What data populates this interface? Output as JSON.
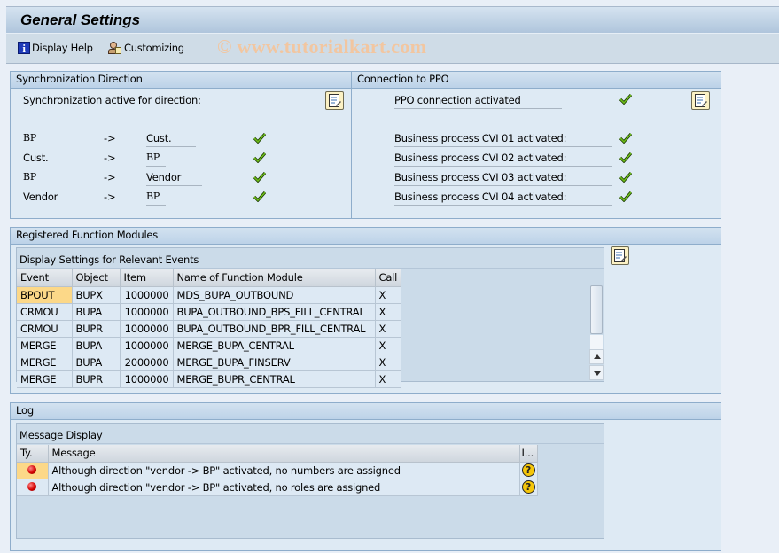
{
  "header": {
    "title": "General Settings",
    "watermark": "© www.tutorialkart.com"
  },
  "toolbar": {
    "display_help": "Display Help",
    "customizing": "Customizing"
  },
  "sync_direction": {
    "title": "Synchronization Direction",
    "label": "Synchronization active for direction:",
    "rows": [
      {
        "from": "BP",
        "arrow": "->",
        "to": "Cust.",
        "active": true
      },
      {
        "from": "Cust.",
        "arrow": "->",
        "to": "BP",
        "active": true
      },
      {
        "from": "BP",
        "arrow": "->",
        "to": "Vendor",
        "active": true
      },
      {
        "from": "Vendor",
        "arrow": "->",
        "to": "BP",
        "active": true
      }
    ]
  },
  "ppo": {
    "title": "Connection to PPO",
    "connection_label": "PPO connection activated",
    "connection_active": true,
    "processes": [
      {
        "label": "Business process CVI 01 activated:",
        "active": true
      },
      {
        "label": "Business process CVI 02 activated:",
        "active": true
      },
      {
        "label": "Business process CVI 03 activated:",
        "active": true
      },
      {
        "label": "Business process CVI 04 activated:",
        "active": true
      }
    ]
  },
  "function_modules": {
    "title": "Registered Function Modules",
    "table_title": "Display Settings for Relevant Events",
    "columns": [
      "Event",
      "Object",
      "Item",
      "Name of Function Module",
      "Call"
    ],
    "rows": [
      [
        "BPOUT",
        "BUPX",
        "1000000",
        "MDS_BUPA_OUTBOUND",
        "X"
      ],
      [
        "CRMOU",
        "BUPA",
        "1000000",
        "BUPA_OUTBOUND_BPS_FILL_CENTRAL",
        "X"
      ],
      [
        "CRMOU",
        "BUPR",
        "1000000",
        "BUPA_OUTBOUND_BPR_FILL_CENTRAL",
        "X"
      ],
      [
        "MERGE",
        "BUPA",
        "1000000",
        "MERGE_BUPA_CENTRAL",
        "X"
      ],
      [
        "MERGE",
        "BUPA",
        "2000000",
        "MERGE_BUPA_FINSERV",
        "X"
      ],
      [
        "MERGE",
        "BUPR",
        "1000000",
        "MERGE_BUPR_CENTRAL",
        "X"
      ]
    ]
  },
  "log": {
    "title": "Log",
    "table_title": "Message Display",
    "columns": [
      "Ty.",
      "Message",
      "I..."
    ],
    "rows": [
      {
        "type": "error",
        "message": "Although direction \"vendor -> BP\" activated, no numbers are assigned",
        "info": "?"
      },
      {
        "type": "error",
        "message": "Although direction \"vendor -> BP\" activated, no roles are assigned",
        "info": "?"
      }
    ]
  }
}
